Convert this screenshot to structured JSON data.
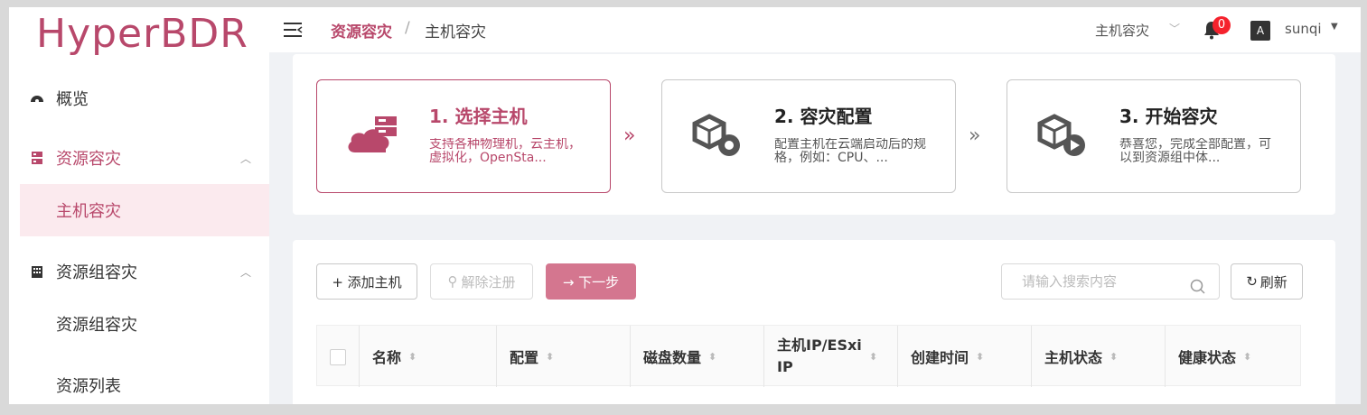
{
  "app": {
    "logo": "HyperBDR"
  },
  "sidebar": {
    "items": [
      {
        "label": "概览",
        "icon": "dashboard-icon"
      },
      {
        "label": "资源容灾",
        "icon": "server-icon",
        "expanded": true
      },
      {
        "label": "主机容灾",
        "selected": true
      },
      {
        "label": "资源组容灾",
        "icon": "building-icon",
        "expanded": true
      },
      {
        "label": "资源组容灾"
      },
      {
        "label": "资源列表"
      }
    ]
  },
  "header": {
    "breadcrumb": [
      "资源容灾",
      "主机容灾"
    ],
    "breadcrumb_sep": "/",
    "mode_select": "主机容灾",
    "notification_count": "0",
    "lang_icon": "A",
    "user": "sunqi"
  },
  "steps": [
    {
      "title": "1. 选择主机",
      "desc": "支持各种物理机，云主机，虚拟化，OpenSta...",
      "active": true,
      "icon": "cloud-server-icon"
    },
    {
      "title": "2. 容灾配置",
      "desc": "配置主机在云端启动后的规格，例如：CPU、...",
      "active": false,
      "icon": "cube-gear-icon"
    },
    {
      "title": "3. 开始容灾",
      "desc": "恭喜您，完成全部配置，可以到资源组中体...",
      "active": false,
      "icon": "cube-play-icon"
    }
  ],
  "step_arrow": "»",
  "toolbar": {
    "add_host": "+ 添加主机",
    "unregister": "解除注册",
    "next": "→  下一步",
    "search_placeholder": "请输入搜索内容",
    "refresh": "刷新"
  },
  "table": {
    "columns": [
      "名称",
      "配置",
      "磁盘数量",
      "主机IP/ESxi IP",
      "创建时间",
      "主机状态",
      "健康状态"
    ]
  },
  "colors": {
    "accent": "#b8486b",
    "primary_button": "#d4768f"
  }
}
